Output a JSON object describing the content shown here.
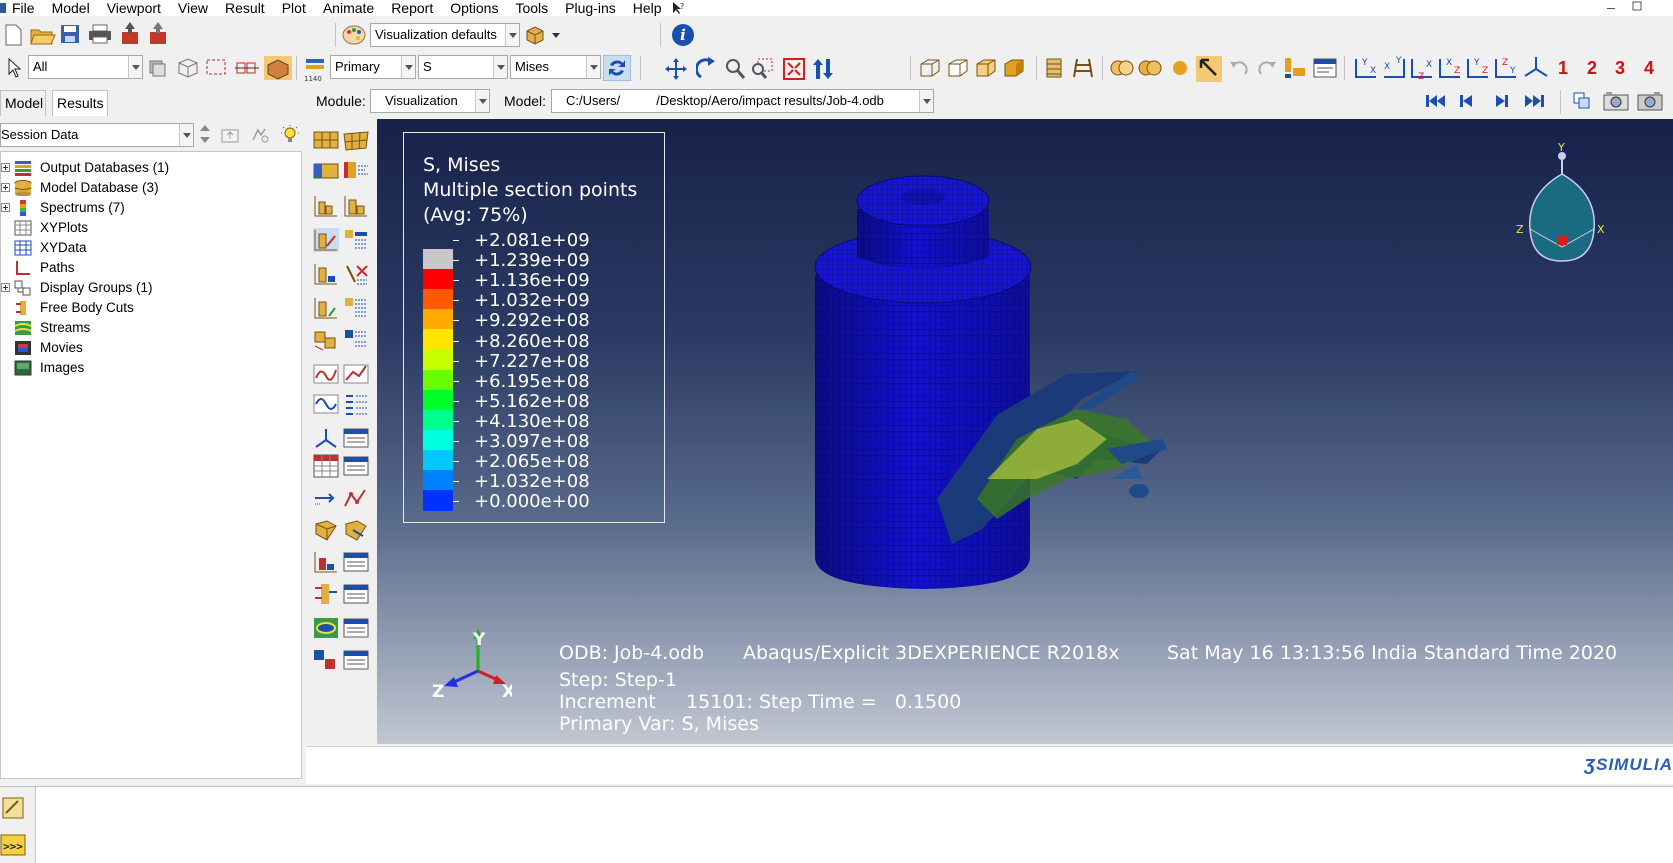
{
  "menu": [
    "File",
    "Model",
    "Viewport",
    "View",
    "Result",
    "Plot",
    "Animate",
    "Report",
    "Options",
    "Tools",
    "Plug-ins",
    "Help"
  ],
  "toolbar": {
    "viz_defaults": "Visualization defaults",
    "selection_filter": "All",
    "field_output_primary": "Primary",
    "field_output_var": "S",
    "field_output_invariant": "Mises",
    "view_numbers": [
      "1",
      "2",
      "3",
      "4"
    ]
  },
  "context": {
    "module_label": "Module:",
    "module_value": "Visualization",
    "model_label": "Model:",
    "model_value": "C:/Users/          /Desktop/Aero/impact results/Job-4.odb"
  },
  "left_panel": {
    "tabs": [
      "Model",
      "Results"
    ],
    "active_tab": "Results",
    "session_combo": "Session Data",
    "tree": [
      {
        "label": "Output Databases (1)",
        "expandable": true,
        "icon": "database-stack-icon"
      },
      {
        "label": "Model Database (3)",
        "expandable": true,
        "icon": "model-database-icon"
      },
      {
        "label": "Spectrums (7)",
        "expandable": true,
        "icon": "spectrum-icon"
      },
      {
        "label": "XYPlots",
        "expandable": false,
        "icon": "xyplot-icon"
      },
      {
        "label": "XYData",
        "expandable": false,
        "icon": "xydata-icon"
      },
      {
        "label": "Paths",
        "expandable": false,
        "icon": "path-icon"
      },
      {
        "label": "Display Groups (1)",
        "expandable": true,
        "icon": "display-group-icon"
      },
      {
        "label": "Free Body Cuts",
        "expandable": false,
        "icon": "free-body-cut-icon"
      },
      {
        "label": "Streams",
        "expandable": false,
        "icon": "streams-icon"
      },
      {
        "label": "Movies",
        "expandable": false,
        "icon": "movies-icon"
      },
      {
        "label": "Images",
        "expandable": false,
        "icon": "images-icon"
      }
    ]
  },
  "legend": {
    "title1": "S, Mises",
    "title2": "Multiple section points",
    "title3": "(Avg: 75%)",
    "values": [
      "+2.081e+09",
      "+1.239e+09",
      "+1.136e+09",
      "+1.032e+09",
      "+9.292e+08",
      "+8.260e+08",
      "+7.227e+08",
      "+6.195e+08",
      "+5.162e+08",
      "+4.130e+08",
      "+3.097e+08",
      "+2.065e+08",
      "+1.032e+08",
      "+0.000e+00"
    ],
    "colors": [
      "#c8c8c8",
      "#ff0000",
      "#ff5a00",
      "#ffaa00",
      "#ffe600",
      "#c8ff00",
      "#6aff00",
      "#00ff28",
      "#00ff8c",
      "#00ffdc",
      "#00c8ff",
      "#0082ff",
      "#0032ff"
    ]
  },
  "info": {
    "odb": "ODB: Job-4.odb",
    "solver": "Abaqus/Explicit 3DEXPERIENCE R2018x",
    "date": "Sat May 16 13:13:56 India Standard Time 2020",
    "step": "Step: Step-1",
    "increment": "Increment     15101: Step Time =   0.1500",
    "primary_var": "Primary Var: S, Mises"
  },
  "triad": {
    "x": "X",
    "y": "Y",
    "z": "Z"
  },
  "brand": "SIMULIA",
  "colors": {
    "viewport_top": "#17224a",
    "viewport_bottom": "#c2c7d2",
    "mesh_blue": "#1414c8"
  }
}
